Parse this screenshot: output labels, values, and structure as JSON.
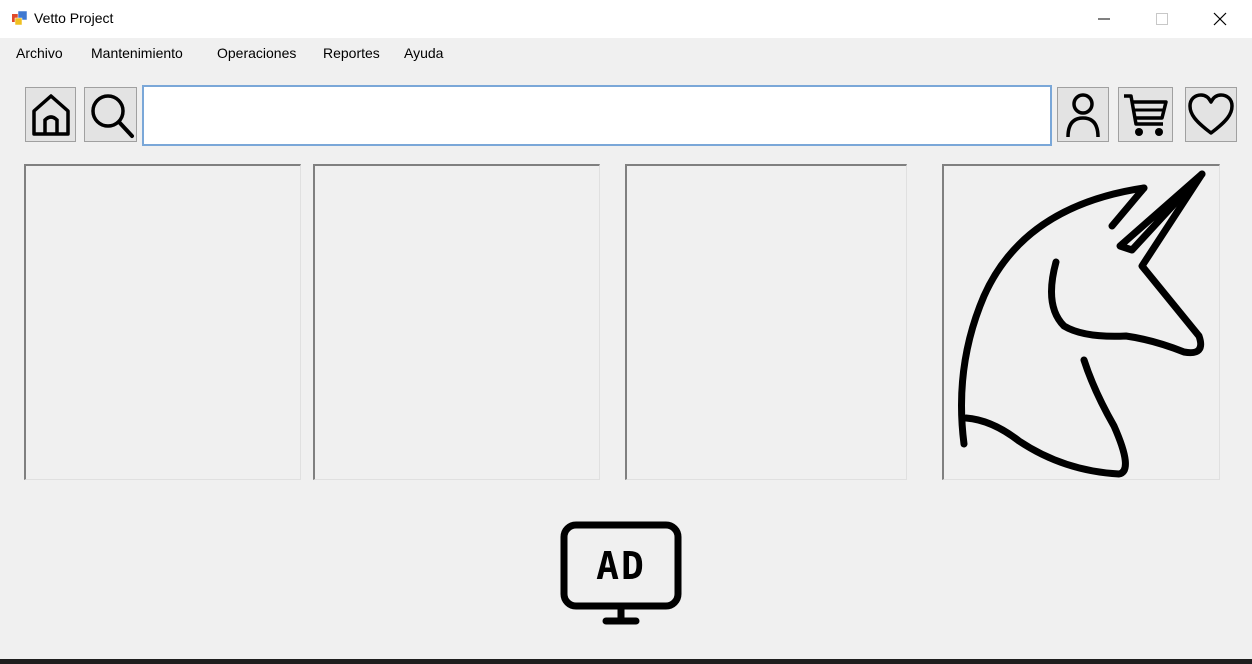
{
  "window": {
    "title": "Vetto Project",
    "minimize_glyph": "—",
    "maximize_glyph": "☐",
    "close_glyph": "✕"
  },
  "menu": {
    "items": [
      "Archivo",
      "Mantenimiento",
      "Operaciones",
      "Reportes",
      "Ayuda"
    ]
  },
  "toolbar": {
    "search_value": "",
    "icons": [
      "home-icon",
      "search-icon",
      "user-icon",
      "cart-icon",
      "heart-icon"
    ]
  },
  "panels": [
    {
      "image": "empty"
    },
    {
      "image": "empty"
    },
    {
      "image": "empty"
    },
    {
      "image": "unicorn-icon"
    }
  ],
  "ad": {
    "label": "AD",
    "icon": "ad-monitor-icon"
  }
}
